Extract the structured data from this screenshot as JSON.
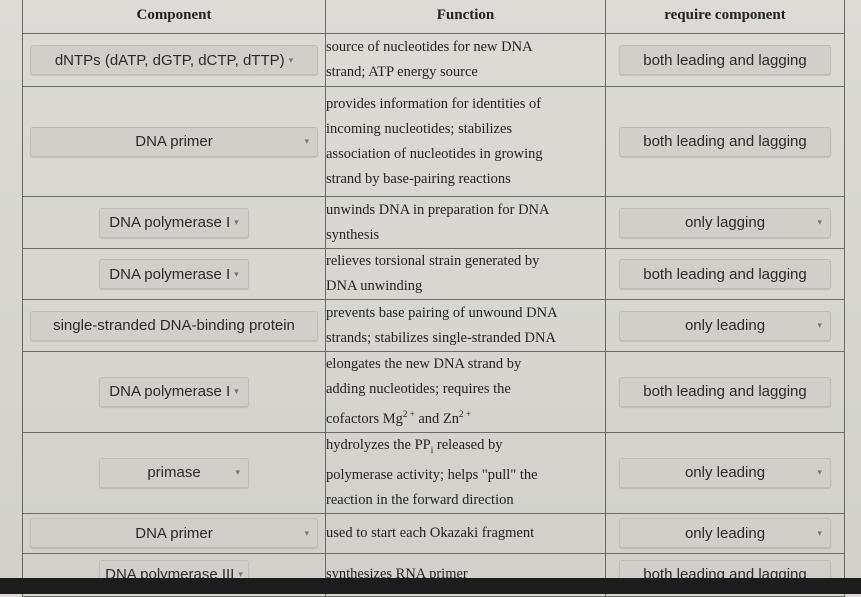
{
  "table": {
    "headers": {
      "component": "Component",
      "function": "Function",
      "require": "require component"
    },
    "rows": [
      {
        "component": "dNTPs (dATP, dGTP, dCTP, dTTP)",
        "function_lines": [
          "source of nucleotides for new DNA",
          "strand; ATP energy source"
        ],
        "require": "both leading and lagging"
      },
      {
        "component": "DNA primer",
        "function_lines": [
          "provides information for identities of",
          "incoming nucleotides; stabilizes",
          "association of nucleotides in growing",
          "strand by base-pairing reactions"
        ],
        "require": "both leading and lagging"
      },
      {
        "component": "DNA polymerase I",
        "function_lines": [
          "unwinds DNA in preparation for DNA",
          "synthesis"
        ],
        "require": "only lagging"
      },
      {
        "component": "DNA polymerase I",
        "function_lines": [
          "relieves torsional strain generated by",
          "DNA unwinding"
        ],
        "require": "both leading and lagging"
      },
      {
        "component": "single-stranded DNA-binding protein",
        "function_lines": [
          "prevents base pairing of unwound DNA",
          "strands; stabilizes single-stranded DNA"
        ],
        "require": "only leading"
      },
      {
        "component": "DNA polymerase I",
        "function_lines": [
          "elongates the new DNA strand by",
          "adding nucleotides; requires the"
        ],
        "function_cofactors": {
          "prefix": "cofactors Mg",
          "sup1": "2 +",
          "mid": " and Zn",
          "sup2": "2 +"
        },
        "require": "both leading and lagging"
      },
      {
        "component": "primase",
        "function_pp": {
          "prefix": "hydrolyzes the PP",
          "sub": "i",
          "suffix": " released by"
        },
        "function_lines": [
          "polymerase activity; helps \"pull\" the",
          "reaction in the forward direction"
        ],
        "require": "only leading"
      },
      {
        "component": "DNA primer",
        "function_lines": [
          "used to start each Okazaki fragment"
        ],
        "require": "only leading"
      },
      {
        "component": "DNA polymerase III",
        "function_lines": [
          "synthesizes RNA primer"
        ],
        "require": "both leading and lagging"
      }
    ]
  },
  "icons": {
    "dropdown_caret": "▾"
  }
}
